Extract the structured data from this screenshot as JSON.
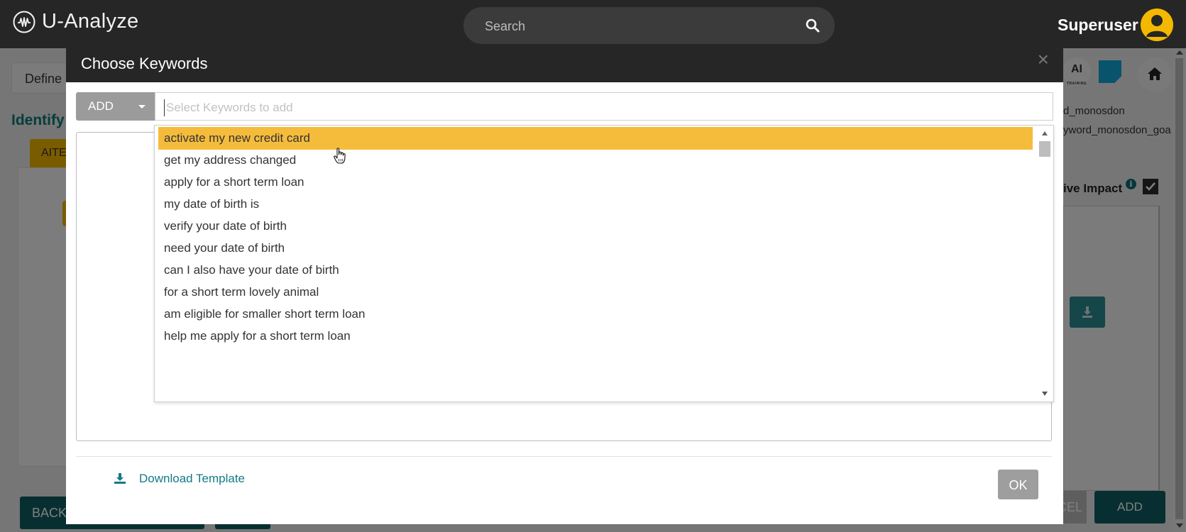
{
  "app": {
    "name": "U-Analyze"
  },
  "search": {
    "placeholder": "Search"
  },
  "user": {
    "name": "Superuser"
  },
  "background": {
    "define_tab": "Define",
    "identify_title": "Identify",
    "aite_tab": "AITE",
    "back_button": "BACK",
    "ai_badge": "AI",
    "ai_badge_sub": "TRAINING",
    "keyword_text_1": "d_monosdon",
    "keyword_text_2": "yword_monosdon_goa",
    "impact_label": "ive Impact",
    "cancel_button": "CEL",
    "add_button": "ADD"
  },
  "modal": {
    "title": "Choose Keywords",
    "close": "×",
    "add_dropdown_label": "ADD",
    "keyword_input_placeholder": "Select Keywords to add",
    "suggestions": [
      {
        "label": "activate my new credit card",
        "highlighted": true
      },
      {
        "label": "get my address changed",
        "highlighted": false
      },
      {
        "label": "apply for a short term loan",
        "highlighted": false
      },
      {
        "label": "my date of birth is",
        "highlighted": false
      },
      {
        "label": "verify your date of birth",
        "highlighted": false
      },
      {
        "label": "need your date of birth",
        "highlighted": false
      },
      {
        "label": "can I also have your date of birth",
        "highlighted": false
      },
      {
        "label": "for a short term lovely animal",
        "highlighted": false
      },
      {
        "label": "am eligible for smaller short term loan",
        "highlighted": false
      },
      {
        "label": "help me apply for a short term loan",
        "highlighted": false
      }
    ],
    "download_template_label": "Download Template",
    "ok_button": "OK"
  },
  "colors": {
    "topbar": "#262626",
    "accent_yellow": "#f5b800",
    "highlight": "#f5bc3c",
    "teal": "#0f5e62",
    "link": "#127a86"
  },
  "icons": {
    "logo": "waveform-logo-icon",
    "search": "search-icon",
    "avatar": "user-avatar-icon",
    "home": "home-icon",
    "note": "sticky-note-icon",
    "download": "download-icon",
    "close": "close-icon",
    "cursor": "hand-pointer-icon"
  }
}
